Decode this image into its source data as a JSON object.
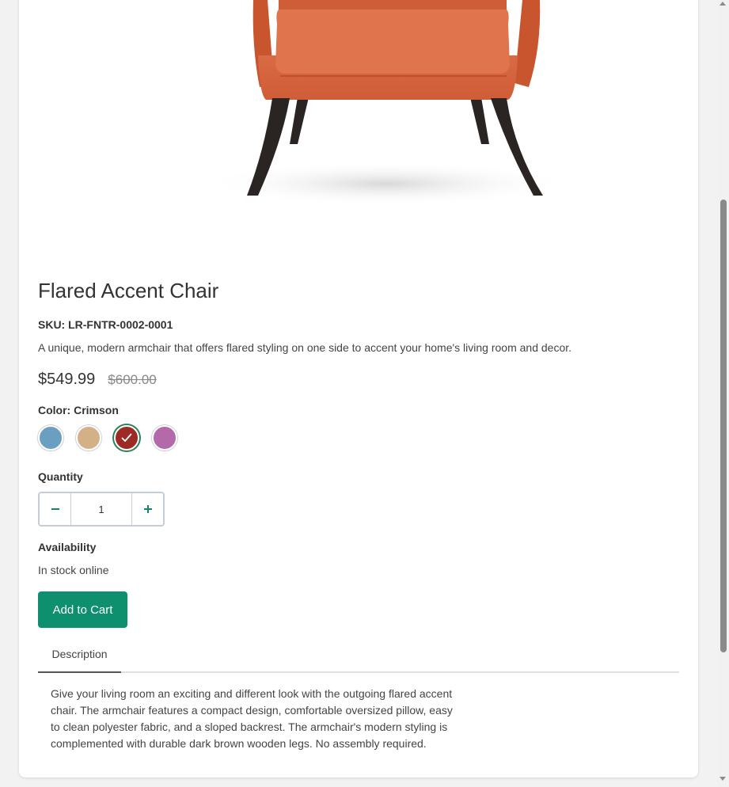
{
  "product": {
    "title": "Flared Accent Chair",
    "sku": "SKU: LR-FNTR-0002-0001",
    "description": "A unique, modern armchair that offers flared styling on one side to accent your home's living room and decor.",
    "price": "$549.99",
    "original_price": "$600.00"
  },
  "color": {
    "label": "Color: Crimson",
    "selected_index": 2,
    "swatches": [
      {
        "name": "Blue",
        "hex": "#6a9fc1"
      },
      {
        "name": "Tan",
        "hex": "#d4b087"
      },
      {
        "name": "Crimson",
        "hex": "#9b2b24"
      },
      {
        "name": "Purple",
        "hex": "#b46aaa"
      }
    ]
  },
  "quantity": {
    "label": "Quantity",
    "value": "1",
    "decrement_icon": "minus-icon",
    "increment_icon": "plus-icon"
  },
  "availability": {
    "label": "Availability",
    "value": "In stock online"
  },
  "actions": {
    "add_to_cart": "Add to Cart"
  },
  "tabs": [
    {
      "label": "Description",
      "content": "Give your living room an exciting and different look with the outgoing flared accent chair. The armchair features a compact design, comfortable oversized pillow, easy to clean polyester fabric, and a sloped backrest. The armchair's modern styling is complemented with durable dark brown wooden legs. No assembly required."
    }
  ],
  "theme": {
    "accent": "#0e8f6e",
    "chair_fabric": "#d9663f",
    "chair_legs": "#2a2522"
  }
}
